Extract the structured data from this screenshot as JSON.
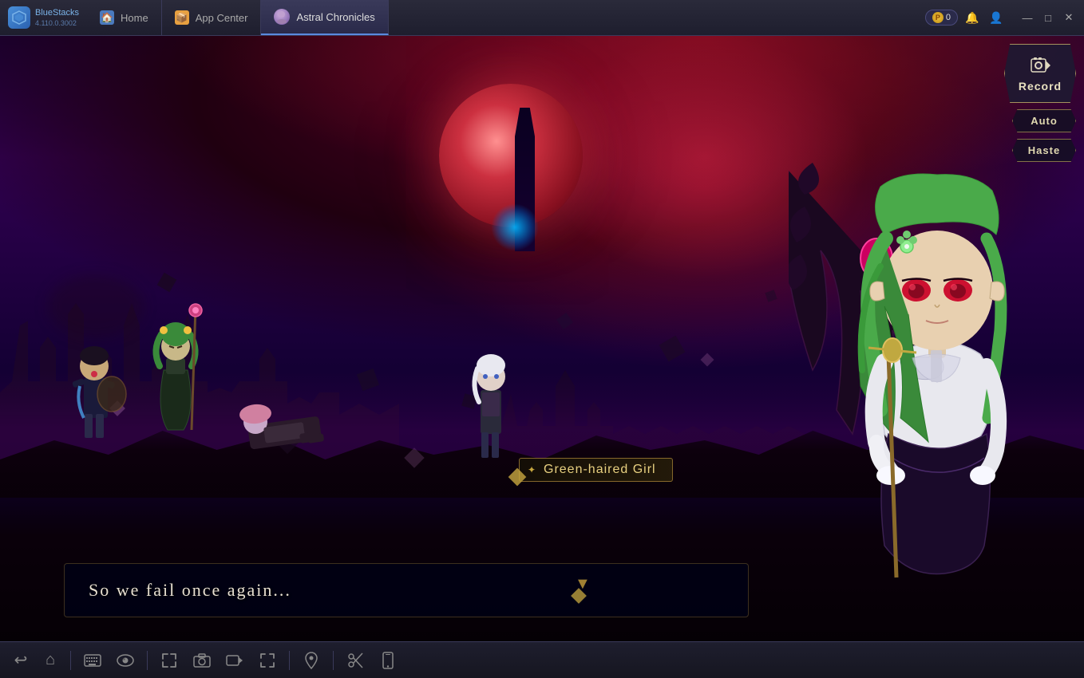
{
  "app": {
    "name": "BlueStacks",
    "version": "4.110.0.3002"
  },
  "titlebar": {
    "tabs": [
      {
        "id": "home",
        "label": "Home",
        "icon": "🏠",
        "active": false
      },
      {
        "id": "appcenter",
        "label": "App Center",
        "icon": "📦",
        "active": false
      },
      {
        "id": "game",
        "label": "Astral Chronicles",
        "icon": "👤",
        "active": true
      }
    ],
    "coins": "0",
    "window_controls": {
      "minimize": "—",
      "maximize": "□",
      "close": "✕"
    }
  },
  "game_ui": {
    "record_button": "Record",
    "auto_button": "Auto",
    "haste_button": "Haste"
  },
  "dialogue": {
    "speaker": "Green-haired Girl",
    "text": "So we fail once again...",
    "speaker_icon": "✦"
  },
  "taskbar": {
    "buttons": [
      {
        "id": "back",
        "icon": "↩",
        "label": "Back"
      },
      {
        "id": "home",
        "icon": "⌂",
        "label": "Home"
      },
      {
        "id": "keyboard",
        "icon": "⌨",
        "label": "Keyboard"
      },
      {
        "id": "camera",
        "icon": "📷",
        "label": "Camera"
      },
      {
        "id": "record",
        "icon": "⏺",
        "label": "Record"
      },
      {
        "id": "screenshot",
        "icon": "📸",
        "label": "Screenshot"
      },
      {
        "id": "fullscreen",
        "icon": "⛶",
        "label": "Fullscreen"
      },
      {
        "id": "location",
        "icon": "📍",
        "label": "Location"
      },
      {
        "id": "scissors",
        "icon": "✂",
        "label": "Scissors"
      },
      {
        "id": "phone",
        "icon": "📱",
        "label": "Phone"
      }
    ]
  }
}
